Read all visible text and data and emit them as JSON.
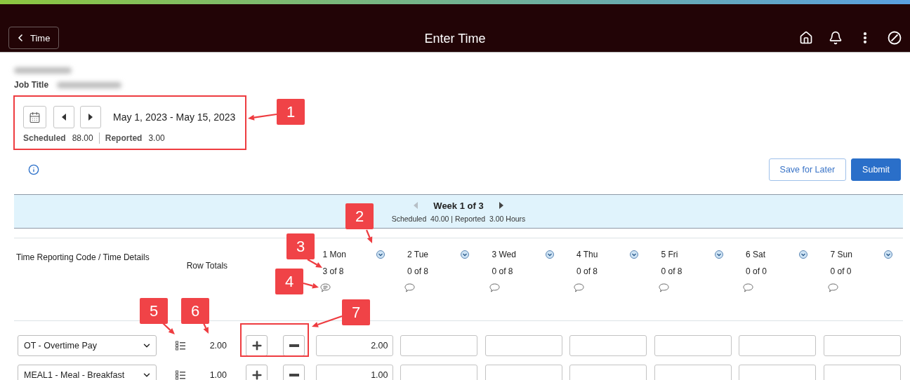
{
  "header": {
    "back_label": "Time",
    "title": "Enter Time"
  },
  "employee": {
    "job_title_label": "Job Title"
  },
  "period": {
    "range": "May 1, 2023 - May 15, 2023",
    "scheduled_label": "Scheduled",
    "scheduled": "88.00",
    "reported_label": "Reported",
    "reported": "3.00"
  },
  "actions": [
    {
      "label": "Save for Later",
      "kind": "secondary"
    },
    {
      "label": "Submit",
      "kind": "primary"
    }
  ],
  "week": {
    "title": "Week 1 of 3",
    "summary": "Scheduled  40.00 | Reported  3.00 Hours"
  },
  "columns": {
    "code": "Time Reporting Code / Time Details",
    "totals": "Row Totals"
  },
  "days": [
    {
      "label": "1 Mon",
      "hours": "3 of 8",
      "commented": true
    },
    {
      "label": "2 Tue",
      "hours": "0 of 8",
      "commented": false
    },
    {
      "label": "3 Wed",
      "hours": "0 of 8",
      "commented": false
    },
    {
      "label": "4 Thu",
      "hours": "0 of 8",
      "commented": false
    },
    {
      "label": "5 Fri",
      "hours": "0 of 8",
      "commented": false
    },
    {
      "label": "6 Sat",
      "hours": "0 of 0",
      "commented": false
    },
    {
      "label": "7 Sun",
      "hours": "0 of 0",
      "commented": false
    }
  ],
  "rows": [
    {
      "code": "OT - Overtime Pay",
      "total": "2.00",
      "values": [
        "2.00"
      ]
    },
    {
      "code": "MEAL1 - Meal - Breakfast",
      "total": "1.00",
      "values": [
        "1.00"
      ]
    }
  ],
  "callouts": [
    {
      "label": "1",
      "framed": true
    },
    {
      "label": "2",
      "framed": false
    },
    {
      "label": "3",
      "framed": false
    },
    {
      "label": "4",
      "framed": false
    },
    {
      "label": "5",
      "framed": false
    },
    {
      "label": "6",
      "framed": false
    },
    {
      "label": "7",
      "framed": true
    }
  ]
}
